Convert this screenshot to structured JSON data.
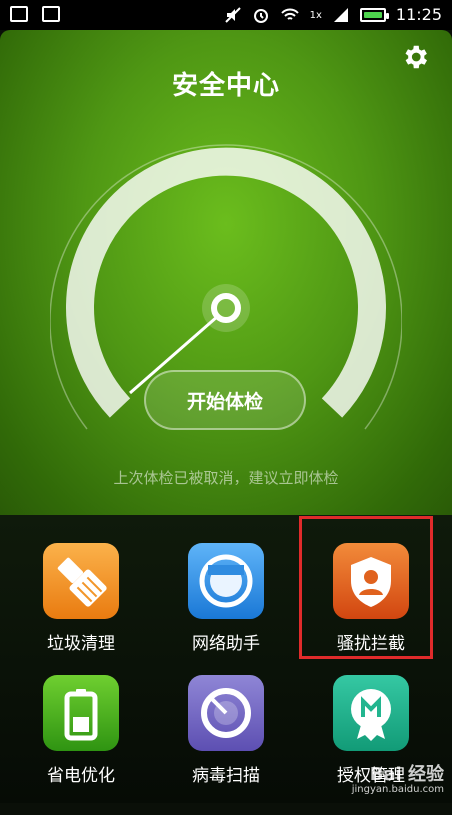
{
  "status_bar": {
    "time": "11:25",
    "network": "1x"
  },
  "header": {
    "title": "安全中心"
  },
  "gauge": {
    "start_button": "开始体检",
    "hint": "上次体检已被取消，建议立即体检"
  },
  "tools": [
    {
      "label": "垃圾清理",
      "icon": "broom-icon",
      "color": "#f2962a"
    },
    {
      "label": "网络助手",
      "icon": "speedometer-icon",
      "color": "#2f8be0"
    },
    {
      "label": "骚扰拦截",
      "icon": "shield-user-icon",
      "color": "#e0621e"
    },
    {
      "label": "省电优化",
      "icon": "battery-icon",
      "color": "#48ad1c"
    },
    {
      "label": "病毒扫描",
      "icon": "scan-icon",
      "color": "#7268c6"
    },
    {
      "label": "授权管理",
      "icon": "badge-icon",
      "color": "#22b58f"
    }
  ],
  "watermark": {
    "text": "Bai 经验",
    "url": "jingyan.baidu.com"
  }
}
